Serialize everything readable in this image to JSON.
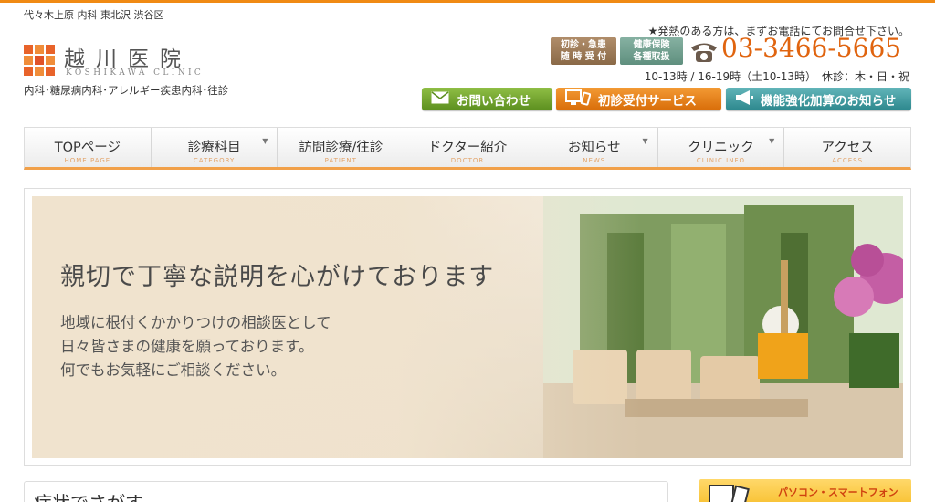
{
  "header": {
    "area": "代々木上原 内科 東北沢 渋谷区",
    "logo_title": "越川医院",
    "logo_sub": "KOSHIKAWA CLINIC",
    "departments": "内科･糖尿病内科･アレルギー疾患内科･往診",
    "fever_note": "★発熱のある方は、まずお電話にてお問合せ下さい。",
    "badge_emergency_line1": "初診・急患",
    "badge_emergency_line2": "随 時 受 付",
    "badge_insurance_line1": "健康保険",
    "badge_insurance_line2": "各種取扱",
    "phone": "03-3466-5665",
    "hours": "10-13時 / 16-19時（土10-13時）　休診：木・日・祝"
  },
  "buttons": {
    "contact": "お問い合わせ",
    "reception": "初診受付サービス",
    "notice": "機能強化加算のお知らせ"
  },
  "nav": [
    {
      "label": "TOPページ",
      "sub": "HOME PAGE",
      "caret": ""
    },
    {
      "label": "診療科目",
      "sub": "CATEGORY",
      "caret": "▼"
    },
    {
      "label": "訪問診療/往診",
      "sub": "PATIENT",
      "caret": ""
    },
    {
      "label": "ドクター紹介",
      "sub": "DOCTOR",
      "caret": ""
    },
    {
      "label": "お知らせ",
      "sub": "NEWS",
      "caret": "▼"
    },
    {
      "label": "クリニック",
      "sub": "CLINIC INFO",
      "caret": "▼"
    },
    {
      "label": "アクセス",
      "sub": "ACCESS",
      "caret": ""
    }
  ],
  "hero": {
    "headline": "親切で丁寧な説明を心がけております",
    "line1": "地域に根付くかかりつけの相談医として",
    "line2": "日々皆さまの健康を願っております。",
    "line3": "何でもお気軽にご相談ください。"
  },
  "search": {
    "title": "症状でさがす"
  },
  "banner": {
    "text": "パソコン・スマートフォン"
  },
  "colors": {
    "accent": "#f08a14",
    "phone": "#e0640f"
  }
}
